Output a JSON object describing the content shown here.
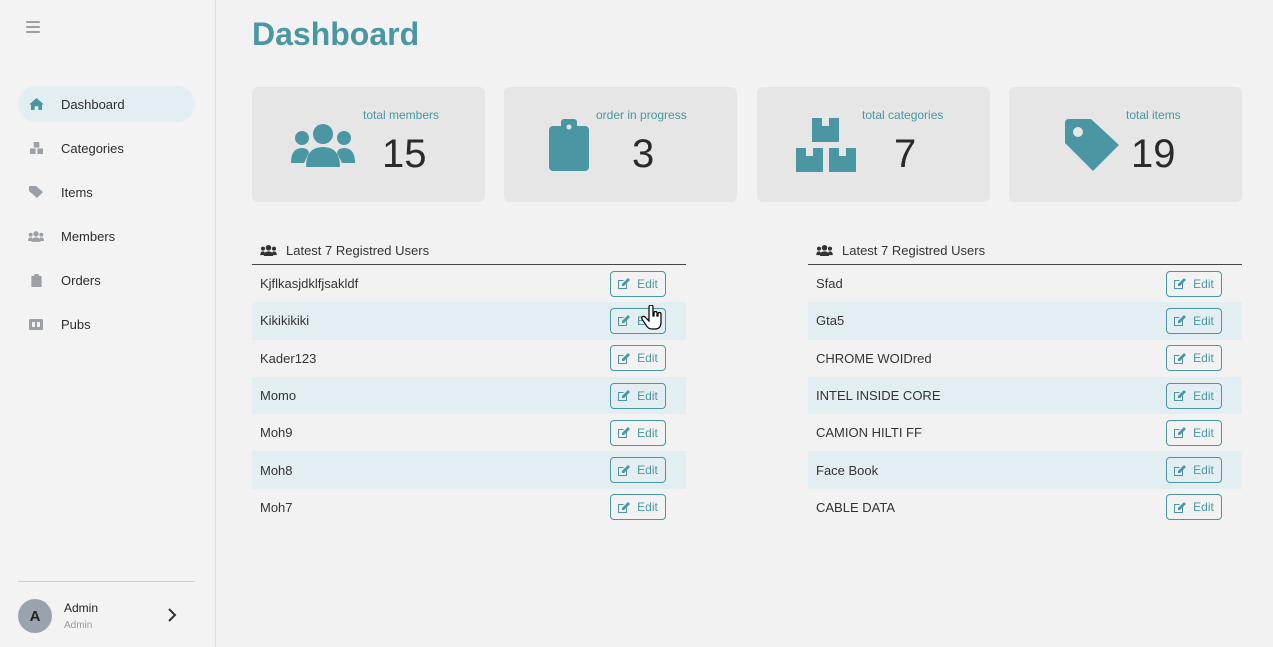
{
  "sidebar": {
    "items": [
      {
        "label": "Dashboard",
        "icon": "home-icon",
        "active": true
      },
      {
        "label": "Categories",
        "icon": "boxes-icon",
        "active": false
      },
      {
        "label": "Items",
        "icon": "tag-icon",
        "active": false
      },
      {
        "label": "Members",
        "icon": "users-icon",
        "active": false
      },
      {
        "label": "Orders",
        "icon": "clipboard-icon",
        "active": false
      },
      {
        "label": "Pubs",
        "icon": "ad-icon",
        "active": false
      }
    ],
    "profile": {
      "initial": "A",
      "name": "Admin",
      "role": "Admin"
    }
  },
  "page": {
    "title": "Dashboard"
  },
  "cards": [
    {
      "label": "total members",
      "value": "15",
      "icon": "users-icon"
    },
    {
      "label": "order in progress",
      "value": "3",
      "icon": "clipboard-icon"
    },
    {
      "label": "total categories",
      "value": "7",
      "icon": "boxes-icon"
    },
    {
      "label": "total items",
      "value": "19",
      "icon": "tag-icon"
    }
  ],
  "tables": [
    {
      "header": "Latest 7 Registred Users",
      "rows": [
        "Kjflkasjdklfjsakldf",
        "Kikikikiki",
        "Kader123",
        "Momo",
        "Moh9",
        "Moh8",
        "Moh7"
      ],
      "edit_label": "Edit"
    },
    {
      "header": "Latest 7 Registred Users",
      "rows": [
        "Sfad",
        "Gta5",
        "CHROME WOIDred",
        "INTEL INSIDE CORE",
        "CAMION HILTI FF",
        "Face Book",
        "CABLE DATA"
      ],
      "edit_label": "Edit"
    }
  ],
  "colors": {
    "accent": "#4a97a3",
    "active_bg": "#e3eef3",
    "card_bg": "#e6e6e6"
  }
}
